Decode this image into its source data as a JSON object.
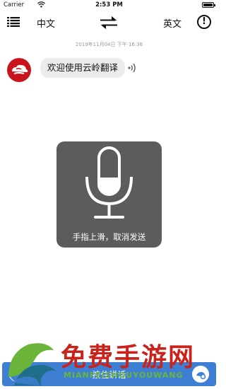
{
  "status_bar": {
    "carrier": "Carrier",
    "time": "2:53 PM",
    "battery_level": 1.0
  },
  "header": {
    "menu_icon": "list-icon",
    "source_language": "中文",
    "swap_icon": "swap-arrows-icon",
    "target_language": "英文",
    "info_icon": "info-icon",
    "info_glyph": "!"
  },
  "chat": {
    "timestamp": "2019年11月04日 下午 16:36",
    "messages": [
      {
        "text": "欢迎使用云岭翻译",
        "avatar_icon": "cloud-logo-icon",
        "audio_icon": "sound-wave-icon"
      }
    ]
  },
  "recording_overlay": {
    "icon": "microphone-icon",
    "hint": "手指上滑，取消发送"
  },
  "bottom_bar": {
    "talk_button_label": "按住讲话",
    "left_icon": "keyboard-toggle-icon",
    "right_icon": "camera-icon"
  },
  "watermark": {
    "text_cn": "免费手游网",
    "text_en": "MIANFEISHOUYOUWANG"
  },
  "colors": {
    "accent": "#3e7fd4",
    "avatar_red": "#c8151d",
    "overlay": "#5c5c5c",
    "watermark_red": "#c9241c",
    "watermark_green": "#6bb43a"
  }
}
